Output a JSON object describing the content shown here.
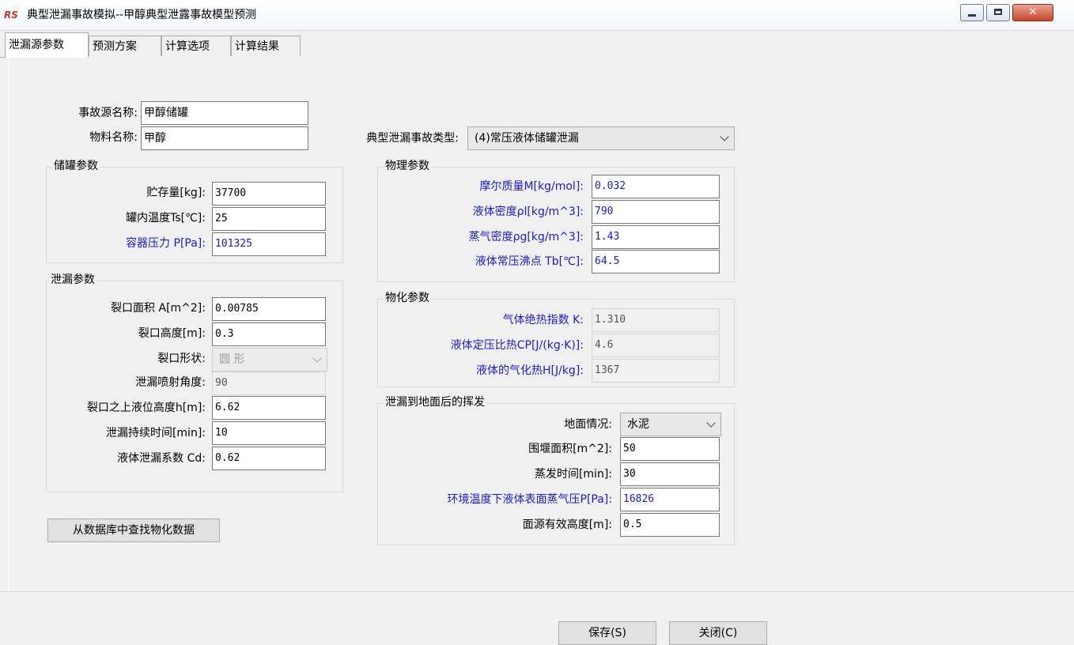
{
  "window": {
    "icon_text": "RS",
    "title": "典型泄漏事故模拟--甲醇典型泄露事故模型预测",
    "close_glyph": "✕"
  },
  "tabs": [
    "泄漏源参数",
    "预测方案",
    "计算选项",
    "计算结果"
  ],
  "source": {
    "name_label": "事故源名称:",
    "name_value": "甲醇储罐",
    "material_label": "物料名称:",
    "material_value": "甲醇",
    "type_label": "典型泄漏事故类型:",
    "type_value": "(4)常压液体储罐泄漏"
  },
  "tank": {
    "title": "储罐参数",
    "fields": [
      {
        "label": "贮存量[kg]:",
        "value": "37700"
      },
      {
        "label": "罐内温度Ts[℃]:",
        "value": "25"
      },
      {
        "label": "容器压力 P[Pa]:",
        "value": "101325"
      }
    ]
  },
  "leak": {
    "title": "泄漏参数",
    "area_label": "裂口面积 A[m^2]:",
    "area_value": "0.00785",
    "height_label": "裂口高度[m]:",
    "height_value": "0.3",
    "shape_label": "裂口形状:",
    "shape_value": "圆 形",
    "angle_label": "泄漏喷射角度:",
    "angle_value": "90",
    "level_label": "裂口之上液位高度h[m]:",
    "level_value": "6.62",
    "duration_label": "泄漏持续时间[min]:",
    "duration_value": "10",
    "coef_label": "液体泄漏系数  Cd:",
    "coef_value": "0.62"
  },
  "physical": {
    "title": "物理参数",
    "fields": [
      {
        "label": "摩尔质量M[kg/mol]:",
        "value": "0.032"
      },
      {
        "label": "液体密度ρl[kg/m^3]:",
        "value": "790"
      },
      {
        "label": "蒸气密度ρg[kg/m^3]:",
        "value": "1.43"
      },
      {
        "label": "液体常压沸点 Tb[℃]:",
        "value": "64.5"
      }
    ]
  },
  "chemical": {
    "title": "物化参数",
    "fields": [
      {
        "label": "气体绝热指数  K:",
        "value": "1.310"
      },
      {
        "label": "液体定压比热CP[J/(kg·K)]:",
        "value": "4.6"
      },
      {
        "label": "液体的气化热H[J/kg]:",
        "value": "1367"
      }
    ]
  },
  "evaporation": {
    "title": "泄漏到地面后的挥发",
    "ground_label": "地面情况:",
    "ground_value": "水泥",
    "dike_label": "围堰面积[m^2]:",
    "dike_value": "50",
    "time_label": "蒸发时间[min]:",
    "time_value": "30",
    "vapor_label": "环境温度下液体表面蒸气压P[Pa]:",
    "vapor_value": "16826",
    "height_label": "面源有效高度[m]:",
    "height_value": "0.5"
  },
  "buttons": {
    "lookup": "从数据库中查找物化数据",
    "save": "保存(S)",
    "close": "关闭(C)"
  }
}
